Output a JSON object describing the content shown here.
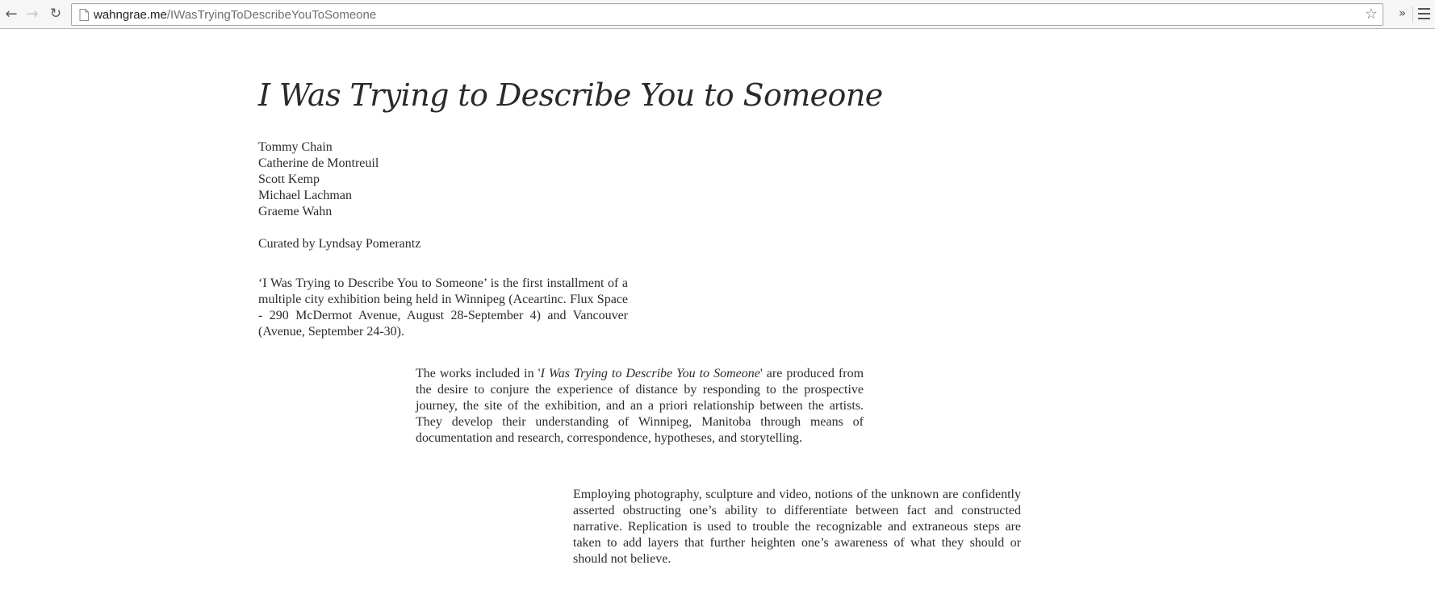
{
  "browser": {
    "url_host": "wahngrae.me",
    "url_path": "/IWasTryingToDescribeYouToSomeone",
    "icons": {
      "back": "back-arrow-icon",
      "forward": "forward-arrow-icon",
      "reload": "reload-icon",
      "page": "page-icon",
      "bookmark": "star-icon",
      "overflow": "double-chevron-icon",
      "menu": "hamburger-menu-icon"
    }
  },
  "page": {
    "title": "I Was Trying to Describe You to Someone",
    "artists": [
      "Tommy Chain",
      "Catherine de Montreuil",
      "Scott Kemp",
      "Michael Lachman",
      "Graeme Wahn"
    ],
    "curated_by": "Curated by Lyndsay Pomerantz",
    "paragraph1": "‘I Was Trying to Describe You to Someone’ is the first installment of a multiple city exhibition being held in Winnipeg (Aceartinc. Flux Space - 290 McDermot Avenue, August 28-September 4) and Vancouver (Avenue, September 24-30).",
    "paragraph2": {
      "before": "The works included in '",
      "em": "I Was Trying to Describe You to Someone",
      "after": "' are produced from the desire to conjure the experience of distance by responding to the prospective journey, the site of the exhibition, and an a priori relationship between the artists. They develop their understanding of Winnipeg, Manitoba through means of documentation and research, correspondence, hypotheses, and storytelling."
    },
    "paragraph3": "Employing photography, sculpture and video, notions of the unknown are confidently asserted obstructing one’s ability to differentiate between fact and constructed narrative. Replication is used to trouble the recognizable and extraneous steps are taken to add layers that further heighten one’s awareness of what they should or should not believe."
  }
}
